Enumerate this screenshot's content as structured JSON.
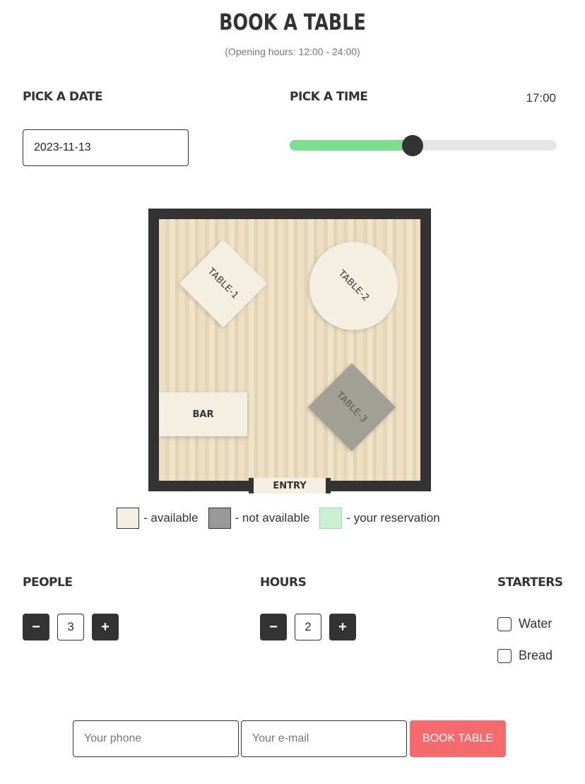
{
  "header": {
    "title": "BOOK A TABLE",
    "subtitle": "(Opening hours: 12:00 - 24:00)"
  },
  "date": {
    "label": "PICK A DATE",
    "value": "2023-11-13"
  },
  "time": {
    "label": "PICK A TIME",
    "value": "17:00",
    "slider_fraction": 0.46
  },
  "floor_plan": {
    "tables": [
      {
        "name": "TABLE-1",
        "status": "available"
      },
      {
        "name": "TABLE-2",
        "status": "available"
      },
      {
        "name": "TABLE-3",
        "status": "not available"
      }
    ],
    "bar_label": "BAR",
    "entry_label": "ENTRY"
  },
  "legend": {
    "available": "- available",
    "not_available": "- not available",
    "your_reservation": "- your reservation"
  },
  "colors": {
    "available": "#f5efe2",
    "not_available": "#999999",
    "your_reservation": "#c9f0d1",
    "slider_fill": "#7ddd8f",
    "button_accent": "#f56a6c"
  },
  "people": {
    "label": "PEOPLE",
    "value": "3",
    "minus": "−",
    "plus": "+"
  },
  "hours": {
    "label": "HOURS",
    "value": "2",
    "minus": "−",
    "plus": "+"
  },
  "starters": {
    "label": "STARTERS",
    "options": [
      "Water",
      "Bread"
    ]
  },
  "contact": {
    "phone_placeholder": "Your phone",
    "email_placeholder": "Your e-mail",
    "submit_label": "BOOK TABLE"
  }
}
